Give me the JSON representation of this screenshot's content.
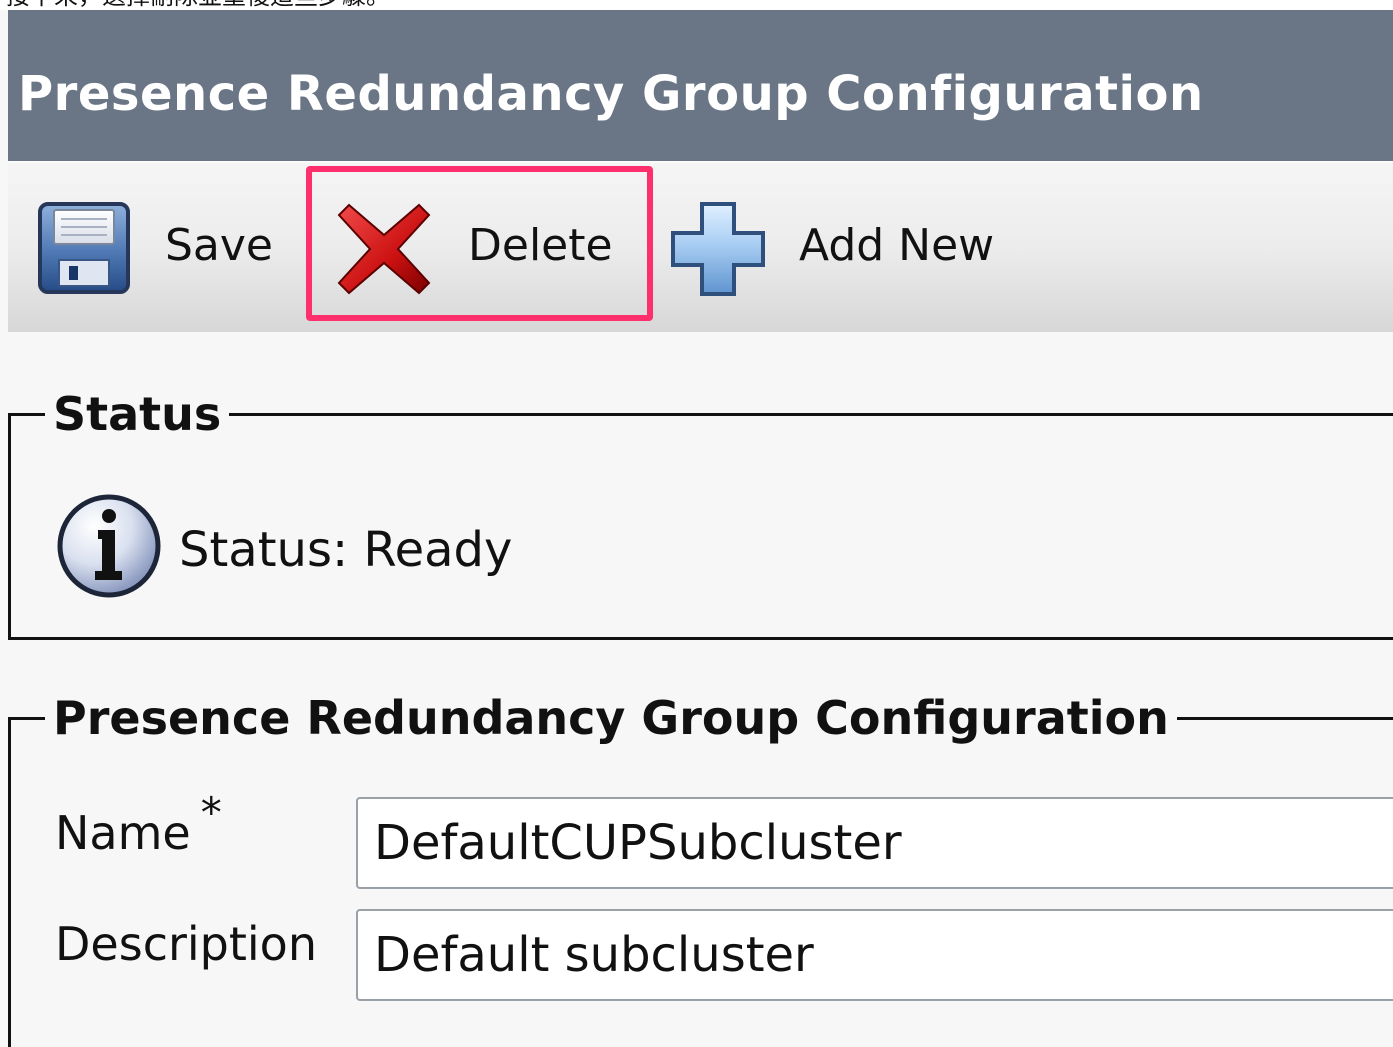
{
  "top_strip": {
    "text": "接下來，選擇刪除並重複這些步驟。"
  },
  "header": {
    "title": "Presence Redundancy Group Configuration"
  },
  "toolbar": {
    "save_label": "Save",
    "delete_label": "Delete",
    "add_new_label": "Add New",
    "save_icon": "floppy-disk-icon",
    "delete_icon": "red-x-icon",
    "add_icon": "blue-plus-icon",
    "highlight_color": "#ff2e6d"
  },
  "status": {
    "legend": "Status",
    "text": "Status: Ready",
    "icon": "info-icon"
  },
  "config": {
    "legend": "Presence Redundancy Group Configuration",
    "name_label": "Name",
    "required_marker": "*",
    "name_value": "DefaultCUPSubcluster",
    "description_label": "Description",
    "description_value": "Default subcluster"
  },
  "colors": {
    "header_bg": "#6a7585",
    "header_text": "#ffffff",
    "page_bg": "#f7f7f7",
    "border": "#111111",
    "input_border": "#9aa0a8"
  }
}
